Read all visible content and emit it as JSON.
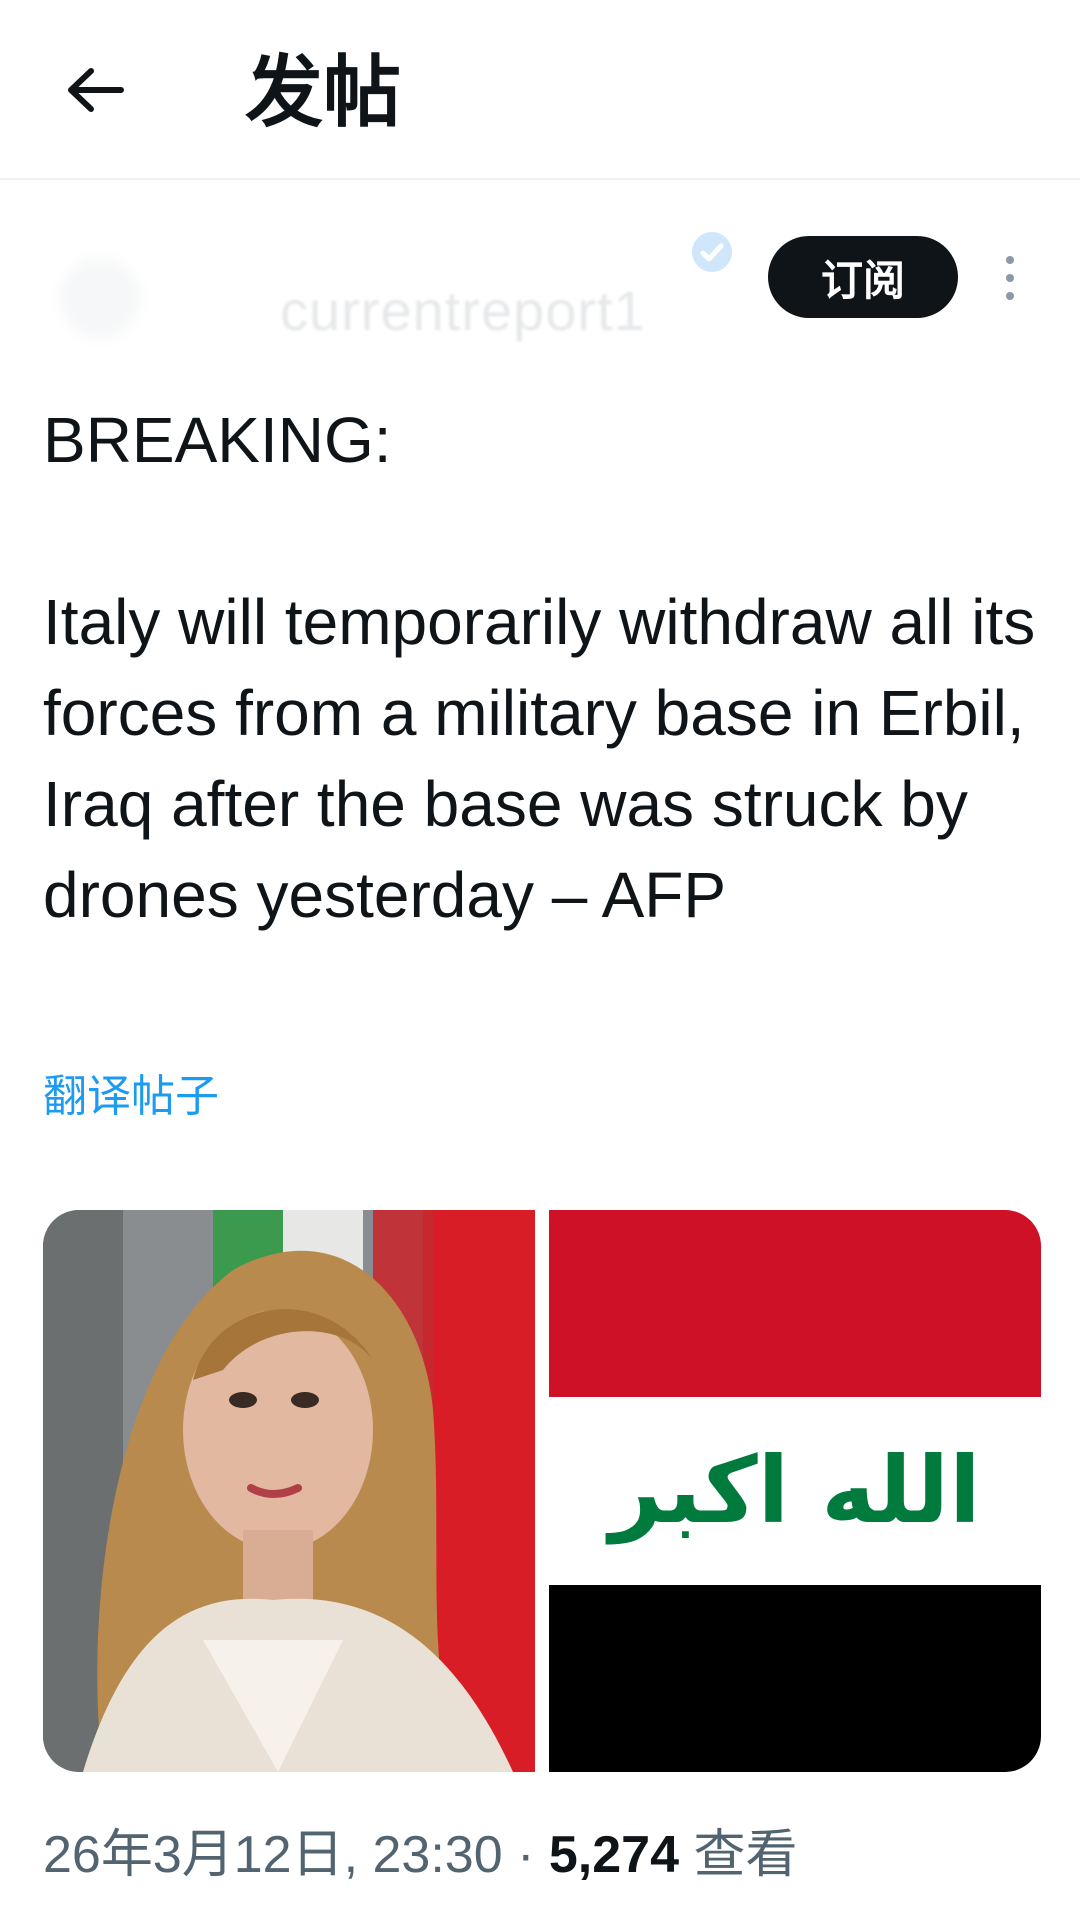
{
  "header": {
    "title": "发帖"
  },
  "author": {
    "handle": "currentreport1"
  },
  "actions": {
    "subscribe_label": "订阅"
  },
  "post": {
    "text": "BREAKING:\n\nItaly will temporarily withdraw all its forces from a military base in Erbil, Iraq after the base was struck by drones yesterday – AFP",
    "translate_label": "翻译帖子"
  },
  "media": {
    "flag_text": "الله اكبر",
    "colors": {
      "flag_red": "#ce1126",
      "flag_white": "#ffffff",
      "flag_black": "#000000",
      "flag_green": "#007a3d"
    }
  },
  "meta": {
    "timestamp": "26年3月12日, 23:30",
    "separator": "·",
    "views_count": "5,274",
    "views_label": "查看"
  },
  "colors": {
    "link": "#1d9bf0",
    "secondary_text": "#536471",
    "primary_text": "#0f1419"
  }
}
